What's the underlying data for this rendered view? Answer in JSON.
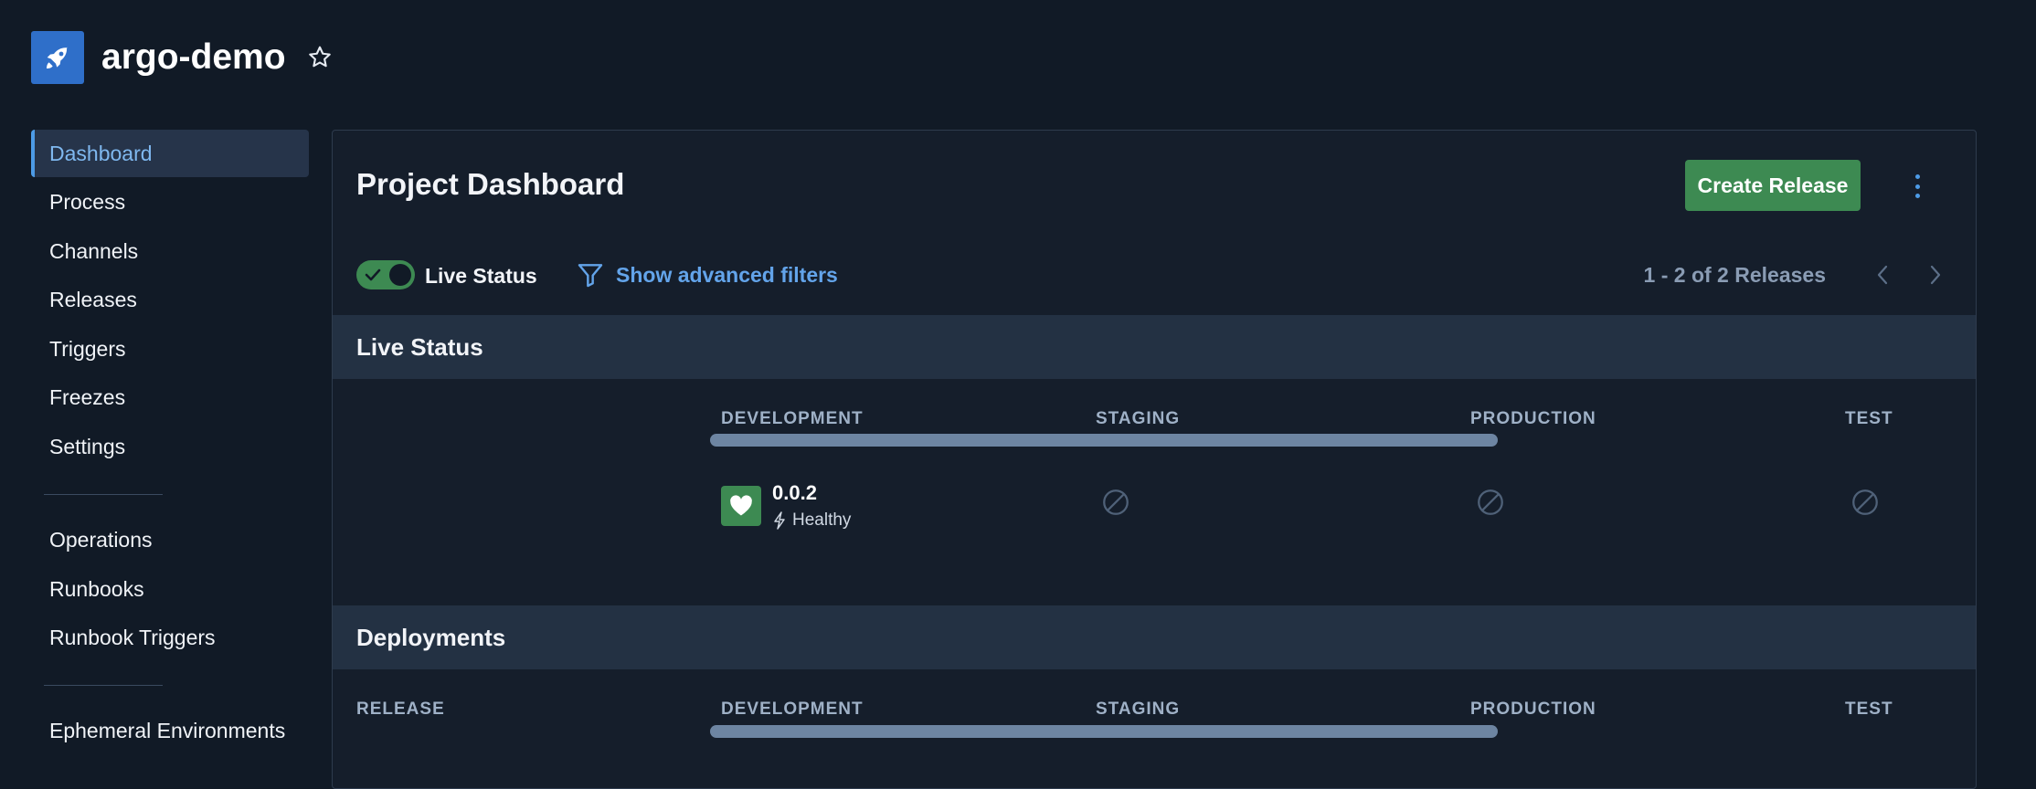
{
  "project": {
    "name": "argo-demo",
    "logo_icon": "rocket-icon"
  },
  "sidebar": {
    "group1": [
      "Dashboard",
      "Process",
      "Channels",
      "Releases",
      "Triggers",
      "Freezes",
      "Settings"
    ],
    "group2": [
      "Operations",
      "Runbooks",
      "Runbook Triggers"
    ],
    "group3": [
      "Ephemeral Environments"
    ],
    "active": "Dashboard"
  },
  "dashboard": {
    "title": "Project Dashboard",
    "create_release_label": "Create Release",
    "live_status_label": "Live Status",
    "live_status_enabled": true,
    "advanced_filters_label": "Show advanced filters",
    "pagination": "1 - 2 of 2 Releases"
  },
  "live_status": {
    "heading": "Live Status",
    "environments": [
      "DEVELOPMENT",
      "STAGING",
      "PRODUCTION",
      "TEST"
    ],
    "release": {
      "version": "0.0.2",
      "status": "Healthy",
      "status_icon": "heart-icon"
    }
  },
  "deployments": {
    "heading": "Deployments",
    "columns": [
      "RELEASE",
      "DEVELOPMENT",
      "STAGING",
      "PRODUCTION",
      "TEST"
    ]
  },
  "colors": {
    "accent": "#4d9be6",
    "success": "#3d8a52",
    "background": "#111a26",
    "panel": "#151e2b"
  }
}
